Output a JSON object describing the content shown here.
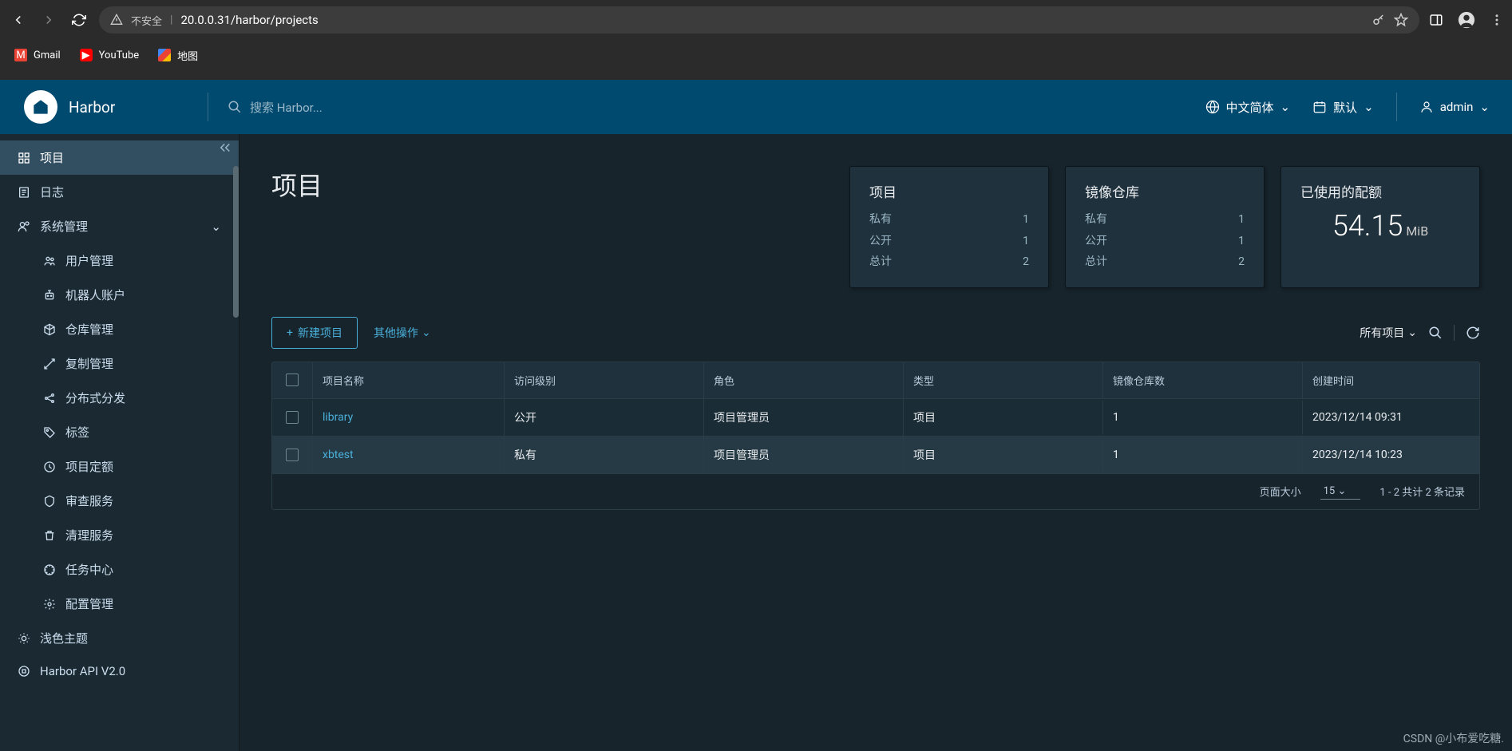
{
  "browser": {
    "url": "20.0.0.31/harbor/projects",
    "insecure_label": "不安全",
    "bookmarks": [
      {
        "label": "Gmail",
        "icon": "gmail"
      },
      {
        "label": "YouTube",
        "icon": "youtube"
      },
      {
        "label": "地图",
        "icon": "maps"
      }
    ]
  },
  "header": {
    "brand": "Harbor",
    "search_placeholder": "搜索 Harbor...",
    "language": "中文简体",
    "theme": "默认",
    "user": "admin"
  },
  "sidebar": {
    "items": [
      {
        "label": "项目",
        "icon": "projects",
        "active": true
      },
      {
        "label": "日志",
        "icon": "logs"
      },
      {
        "label": "系统管理",
        "icon": "admin",
        "expanded": true,
        "children": [
          {
            "label": "用户管理",
            "icon": "users"
          },
          {
            "label": "机器人账户",
            "icon": "robot"
          },
          {
            "label": "仓库管理",
            "icon": "repo"
          },
          {
            "label": "复制管理",
            "icon": "replication"
          },
          {
            "label": "分布式分发",
            "icon": "distribute"
          },
          {
            "label": "标签",
            "icon": "tag"
          },
          {
            "label": "项目定额",
            "icon": "quota"
          },
          {
            "label": "审查服务",
            "icon": "scan"
          },
          {
            "label": "清理服务",
            "icon": "gc"
          },
          {
            "label": "任务中心",
            "icon": "jobs"
          },
          {
            "label": "配置管理",
            "icon": "config"
          }
        ]
      },
      {
        "label": "浅色主题",
        "icon": "theme"
      },
      {
        "label": "Harbor API V2.0",
        "icon": "api"
      }
    ]
  },
  "page": {
    "title": "项目",
    "summary": {
      "projects": {
        "title": "项目",
        "rows": [
          {
            "label": "私有",
            "value": "1"
          },
          {
            "label": "公开",
            "value": "1"
          },
          {
            "label": "总计",
            "value": "2"
          }
        ]
      },
      "repos": {
        "title": "镜像仓库",
        "rows": [
          {
            "label": "私有",
            "value": "1"
          },
          {
            "label": "公开",
            "value": "1"
          },
          {
            "label": "总计",
            "value": "2"
          }
        ]
      },
      "quota": {
        "title": "已使用的配额",
        "value": "54.15",
        "unit": "MiB"
      }
    },
    "actions": {
      "new_project": "新建项目",
      "other_actions": "其他操作",
      "filter_label": "所有项目"
    },
    "table": {
      "columns": [
        "项目名称",
        "访问级别",
        "角色",
        "类型",
        "镜像仓库数",
        "创建时间"
      ],
      "rows": [
        {
          "name": "library",
          "access": "公开",
          "role": "项目管理员",
          "type": "项目",
          "repos": "1",
          "created": "2023/12/14 09:31",
          "selected": false
        },
        {
          "name": "xbtest",
          "access": "私有",
          "role": "项目管理员",
          "type": "项目",
          "repos": "1",
          "created": "2023/12/14 10:23",
          "selected": true
        }
      ],
      "footer": {
        "page_size_label": "页面大小",
        "page_size": "15",
        "summary": "1 - 2 共计 2 条记录"
      }
    }
  },
  "watermark": "CSDN @小布爱吃糖."
}
